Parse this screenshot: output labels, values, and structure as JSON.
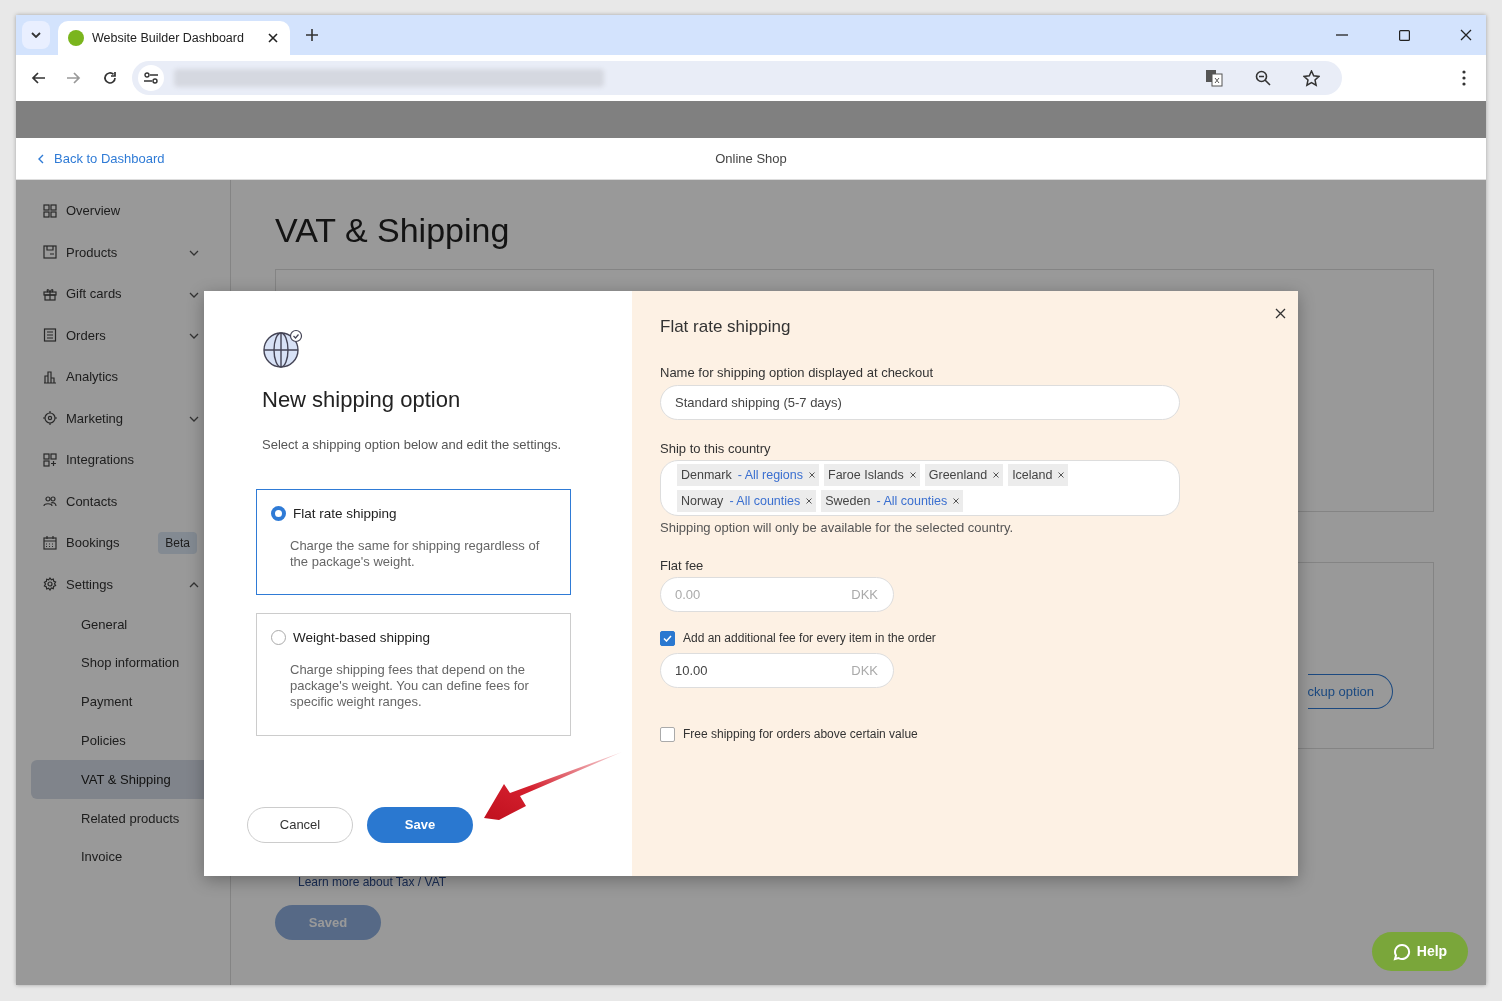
{
  "browser": {
    "tab_title": "Website Builder Dashboard"
  },
  "header": {
    "back_link": "Back to Dashboard",
    "title": "Online Shop"
  },
  "sidebar": {
    "items": [
      {
        "label": "Overview",
        "kind": "link",
        "selected": false
      },
      {
        "label": "Products",
        "kind": "group",
        "expanded": false,
        "selected": false
      },
      {
        "label": "Gift cards",
        "kind": "group",
        "expanded": false,
        "selected": false
      },
      {
        "label": "Orders",
        "kind": "group",
        "expanded": false,
        "selected": false
      },
      {
        "label": "Analytics",
        "kind": "link",
        "selected": false
      },
      {
        "label": "Marketing",
        "kind": "group",
        "expanded": false,
        "selected": false
      },
      {
        "label": "Integrations",
        "kind": "link",
        "selected": false
      },
      {
        "label": "Contacts",
        "kind": "link",
        "selected": false
      },
      {
        "label": "Bookings",
        "kind": "link",
        "badge": "Beta",
        "selected": false
      },
      {
        "label": "Settings",
        "kind": "group",
        "expanded": true,
        "selected": false,
        "children": [
          {
            "label": "General",
            "selected": false
          },
          {
            "label": "Shop information",
            "selected": false
          },
          {
            "label": "Payment",
            "selected": false
          },
          {
            "label": "Policies",
            "selected": false
          },
          {
            "label": "VAT & Shipping",
            "selected": true
          },
          {
            "label": "Related products",
            "selected": false
          },
          {
            "label": "Invoice",
            "selected": false
          }
        ]
      }
    ]
  },
  "page": {
    "title": "VAT & Shipping",
    "pickup_button": "ckup option",
    "learn_link": "Learn more about Tax / VAT",
    "saved_button": "Saved"
  },
  "modal": {
    "heading": "New shipping option",
    "description": "Select a shipping option below and edit the settings.",
    "options": [
      {
        "title": "Flat rate shipping",
        "description": "Charge the same for shipping regardless of the package's weight.",
        "selected": true
      },
      {
        "title": "Weight-based shipping",
        "description": "Charge shipping fees that depend on the package's weight. You can define fees for specific weight ranges.",
        "selected": false
      }
    ],
    "cancel_button": "Cancel",
    "save_button": "Save",
    "settings": {
      "heading": "Flat rate shipping",
      "name_field": {
        "label": "Name for shipping option displayed at checkout",
        "value": "Standard shipping (5-7 days)"
      },
      "countries": {
        "label": "Ship to this country",
        "tags": [
          {
            "name": "Denmark",
            "scope": "- All regions"
          },
          {
            "name": "Faroe Islands"
          },
          {
            "name": "Greenland"
          },
          {
            "name": "Iceland"
          },
          {
            "name": "Norway",
            "scope": "- All counties"
          },
          {
            "name": "Sweden",
            "scope": "- All counties"
          }
        ],
        "hint": "Shipping option will only be available for the selected country."
      },
      "flat_fee": {
        "label": "Flat fee",
        "placeholder": "0.00",
        "unit": "DKK"
      },
      "additional_fee": {
        "label": "Add an additional fee for every item in the order",
        "checked": true,
        "value": "10.00",
        "unit": "DKK"
      },
      "free_shipping": {
        "label": "Free shipping for orders above certain value",
        "checked": false
      }
    }
  },
  "help_button": "Help"
}
